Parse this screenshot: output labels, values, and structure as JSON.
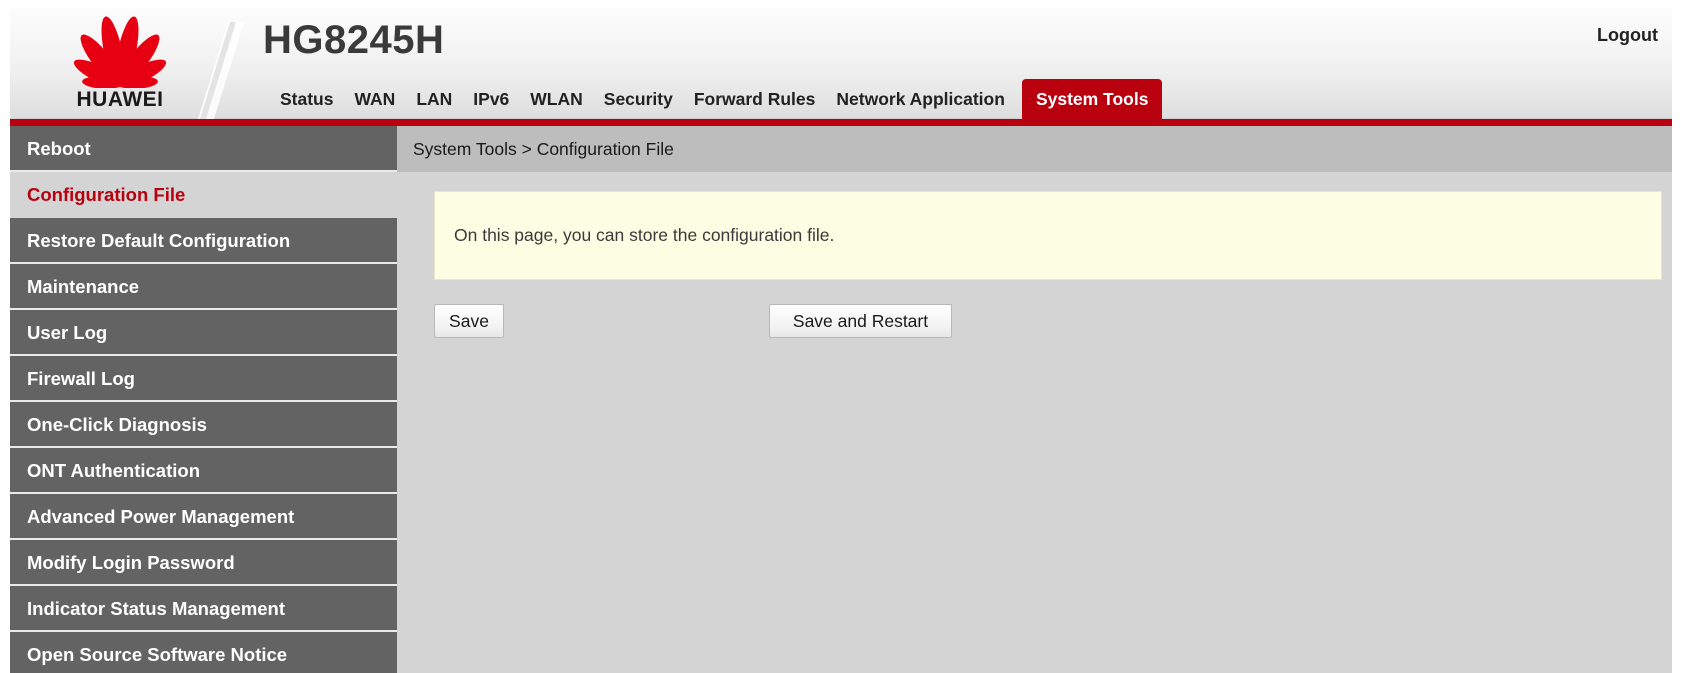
{
  "brand": {
    "logo_text": "HUAWEI",
    "model": "HG8245H",
    "color": "#b8000e"
  },
  "header": {
    "logout_label": "Logout"
  },
  "nav": {
    "items": [
      {
        "label": "Status"
      },
      {
        "label": "WAN"
      },
      {
        "label": "LAN"
      },
      {
        "label": "IPv6"
      },
      {
        "label": "WLAN"
      },
      {
        "label": "Security"
      },
      {
        "label": "Forward Rules"
      },
      {
        "label": "Network Application"
      },
      {
        "label": "System Tools",
        "active": true
      }
    ]
  },
  "sidebar": {
    "items": [
      {
        "label": "Reboot"
      },
      {
        "label": "Configuration File",
        "active": true
      },
      {
        "label": "Restore Default Configuration"
      },
      {
        "label": "Maintenance"
      },
      {
        "label": "User Log"
      },
      {
        "label": "Firewall Log"
      },
      {
        "label": "One-Click Diagnosis"
      },
      {
        "label": "ONT Authentication"
      },
      {
        "label": "Advanced Power Management"
      },
      {
        "label": "Modify Login Password"
      },
      {
        "label": "Indicator Status Management"
      },
      {
        "label": "Open Source Software Notice"
      }
    ]
  },
  "main": {
    "breadcrumb": "System Tools > Configuration File",
    "description": "On this page, you can store the configuration file.",
    "save_label": "Save",
    "save_restart_label": "Save and Restart"
  }
}
